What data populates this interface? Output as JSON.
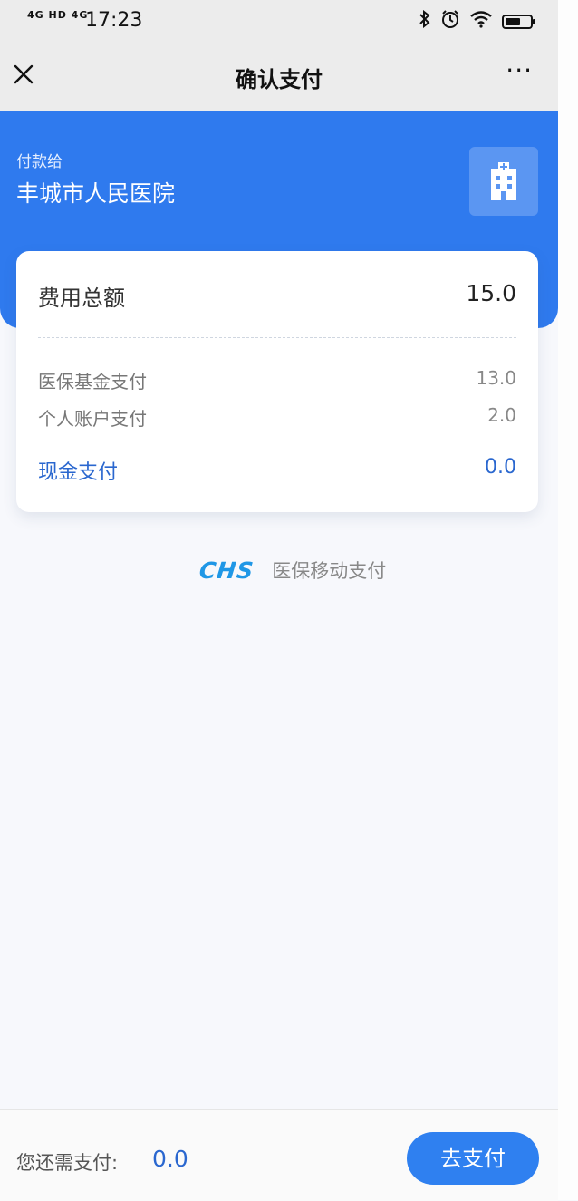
{
  "status_bar": {
    "signal_text": "4G HD 4G",
    "time": "17:23",
    "icons": [
      "bluetooth-icon",
      "alarm-icon",
      "wifi-icon",
      "battery-icon"
    ],
    "battery_level": 0.6
  },
  "nav": {
    "title": "确认支付",
    "close_icon": "close-icon",
    "more_icon": "more-icon",
    "more_text": "···"
  },
  "payee": {
    "label": "付款给",
    "name": "丰城市人民医院",
    "icon": "hospital-icon"
  },
  "summary": {
    "total_label": "费用总额",
    "total_value": "15.0",
    "rows": [
      {
        "label": "医保基金支付",
        "value": "13.0"
      },
      {
        "label": "个人账户支付",
        "value": "2.0"
      }
    ],
    "cash": {
      "label": "现金支付",
      "value": "0.0"
    }
  },
  "brand": {
    "logo_text": "CHS",
    "text": "医保移动支付"
  },
  "footer": {
    "remaining_label": "您还需支付:",
    "remaining_value": "0.0",
    "pay_button_label": "去支付"
  },
  "colors": {
    "primary_blue": "#2f7aee",
    "link_blue": "#2a67cf",
    "logo_blue": "#1f97e6",
    "background": "#f7f8fc"
  }
}
